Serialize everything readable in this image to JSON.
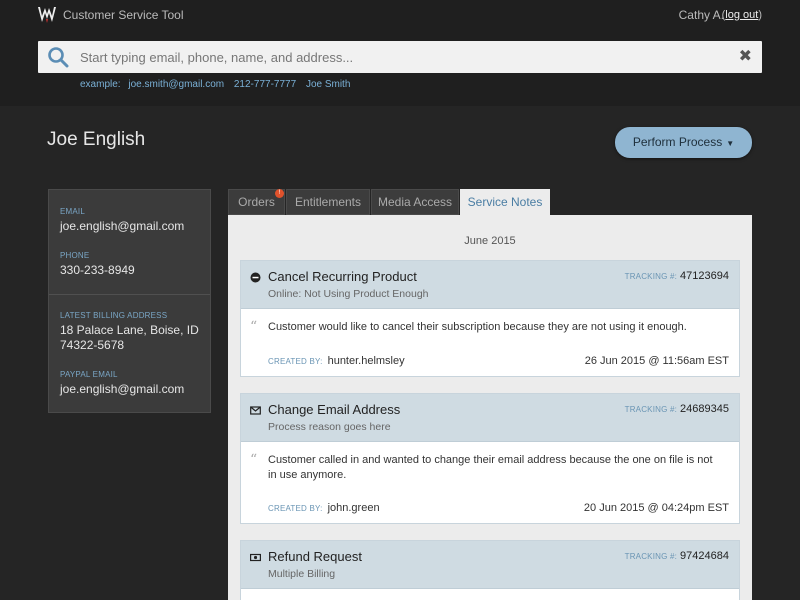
{
  "header": {
    "app_title": "Customer Service Tool",
    "user_name": "Cathy A.",
    "logout_label": "log out"
  },
  "search": {
    "placeholder": "Start typing email, phone, name, and address...",
    "examples_label": "example:",
    "examples": [
      "joe.smith@gmail.com",
      "212-777-7777",
      "Joe Smith"
    ]
  },
  "customer": {
    "name": "Joe English",
    "email_label": "EMAIL",
    "email": "joe.english@gmail.com",
    "phone_label": "PHONE",
    "phone": "330-233-8949",
    "billing_label": "LATEST BILLING ADDRESS",
    "billing_line1": "18 Palace Lane, Boise, ID",
    "billing_line2": "74322-5678",
    "paypal_label": "PAYPAL EMAIL",
    "paypal_email": "joe.english@gmail.com"
  },
  "actions": {
    "perform_process": "Perform Process"
  },
  "tabs": [
    {
      "label": "Orders",
      "badge": "!"
    },
    {
      "label": "Entitlements"
    },
    {
      "label": "Media Access"
    },
    {
      "label": "Service Notes",
      "active": true
    }
  ],
  "notes": {
    "month": "June 2015",
    "tracking_label": "TRACKING #:",
    "created_label": "CREATED BY:",
    "items": [
      {
        "icon": "minus-circle-icon",
        "title": "Cancel Recurring Product",
        "subtitle": "Online: Not Using Product Enough",
        "tracking": "47123694",
        "text": "Customer would like to cancel their subscription because they are not using it enough.",
        "created_by": "hunter.helmsley",
        "timestamp": "26 Jun 2015 @ 11:56am EST"
      },
      {
        "icon": "envelope-icon",
        "title": "Change Email Address",
        "subtitle": "Process reason goes here",
        "tracking": "24689345",
        "text": "Customer called in and wanted to change their email address because the one on file is not in use anymore.",
        "created_by": "john.green",
        "timestamp": "20 Jun 2015 @ 04:24pm EST"
      },
      {
        "icon": "money-icon",
        "title": "Refund Request",
        "subtitle": "Multiple Billing",
        "tracking": "97424684"
      }
    ]
  },
  "colors": {
    "accent": "#8fb5d1",
    "link": "#7ab0d6",
    "badge": "#e0522c"
  }
}
